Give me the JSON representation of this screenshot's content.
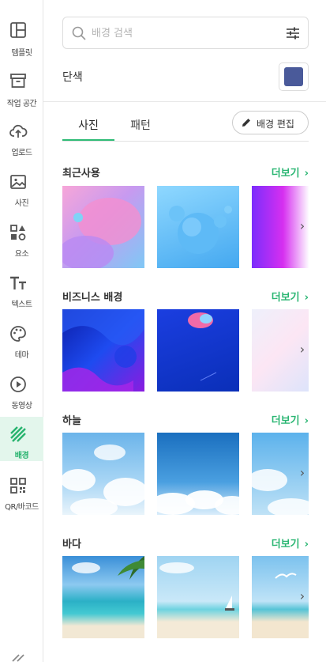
{
  "sidebar": {
    "items": [
      {
        "label": "템플릿",
        "icon": "template-icon"
      },
      {
        "label": "작업 공간",
        "icon": "archive-box-icon"
      },
      {
        "label": "업로드",
        "icon": "cloud-upload-icon"
      },
      {
        "label": "사진",
        "icon": "image-icon"
      },
      {
        "label": "요소",
        "icon": "shapes-icon"
      },
      {
        "label": "텍스트",
        "icon": "text-icon"
      },
      {
        "label": "테마",
        "icon": "palette-icon"
      },
      {
        "label": "동영상",
        "icon": "play-circle-icon"
      },
      {
        "label": "배경",
        "icon": "background-stripes-icon",
        "active": true
      },
      {
        "label": "QR/바코드",
        "icon": "qr-code-icon"
      }
    ]
  },
  "search": {
    "placeholder": "배경 검색",
    "value": ""
  },
  "solid": {
    "label": "단색",
    "color": "#4a5a9a"
  },
  "tabs": [
    {
      "label": "사진",
      "active": true
    },
    {
      "label": "패턴",
      "active": false
    }
  ],
  "edit_button": {
    "label": "배경 편집"
  },
  "more_label": "더보기",
  "sections": [
    {
      "title": "최근사용"
    },
    {
      "title": "비즈니스 배경"
    },
    {
      "title": "하늘"
    },
    {
      "title": "바다"
    }
  ],
  "colors": {
    "accent": "#2bb673",
    "active_bg": "#e3f6ec"
  }
}
